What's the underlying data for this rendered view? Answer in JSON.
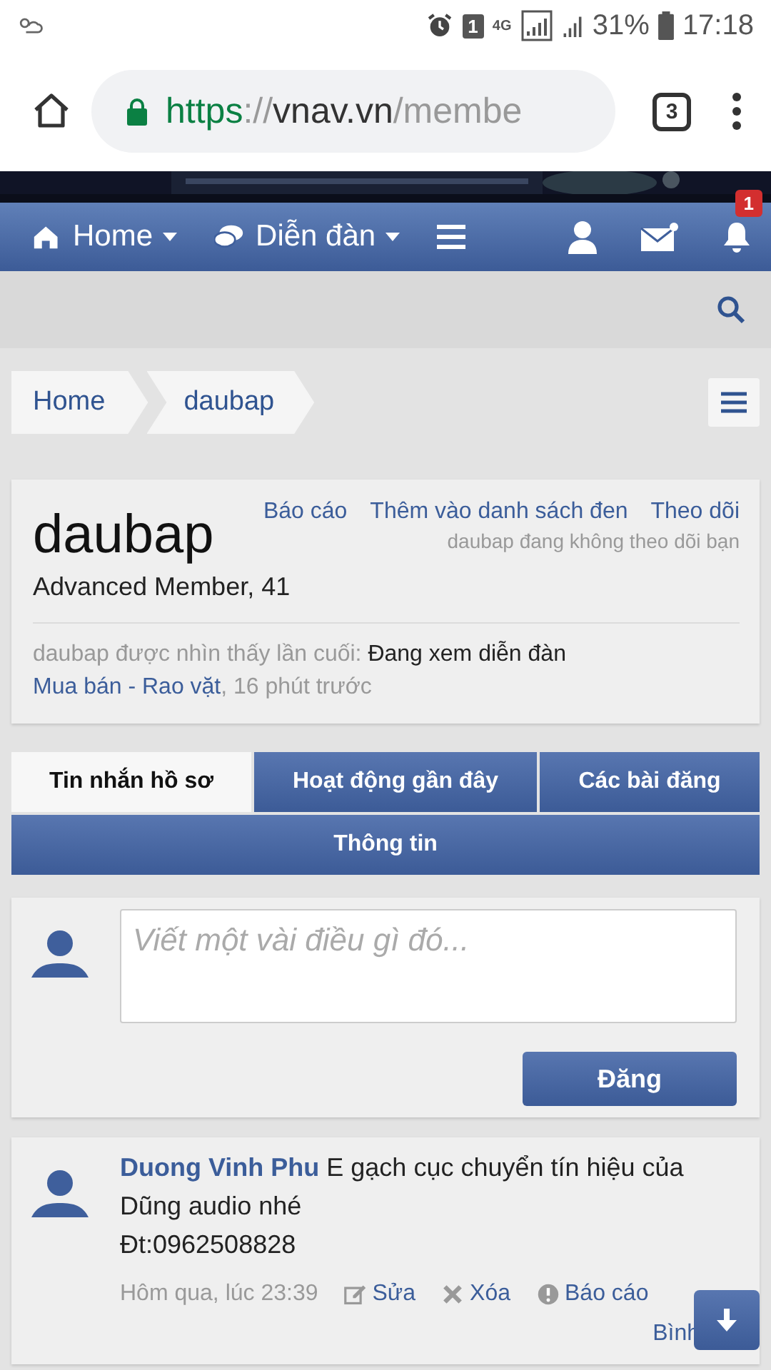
{
  "status_bar": {
    "sim_slot": "1",
    "network": "4G",
    "battery": "31%",
    "time": "17:18"
  },
  "browser": {
    "url": {
      "scheme": "https",
      "separator": "://",
      "host": "vnav.vn",
      "path": "/membe"
    },
    "tab_count": "3"
  },
  "nav": {
    "items": [
      {
        "label": "Home",
        "kind": "home"
      },
      {
        "label": "Diễn đàn",
        "kind": "forum"
      }
    ],
    "alerts_badge": "1"
  },
  "breadcrumb": [
    {
      "label": "Home"
    },
    {
      "label": "daubap"
    }
  ],
  "profile": {
    "name": "daubap",
    "actions": [
      "Báo cáo",
      "Thêm vào danh sách đen",
      "Theo dõi"
    ],
    "follow_note": "daubap đang không theo dõi bạn",
    "title": "Advanced Member, 41",
    "last_seen": {
      "label": "daubap được nhìn thấy lần cuối:",
      "activity": "Đang xem diễn đàn",
      "link": "Mua bán - Rao vặt",
      "ago": ", 16 phút trước"
    }
  },
  "tabs": [
    {
      "label": "Tin nhắn hồ sơ",
      "selected": true
    },
    {
      "label": "Hoạt động gần đây",
      "selected": false
    },
    {
      "label": "Các bài đăng",
      "selected": false
    },
    {
      "label": "Thông tin",
      "selected": false
    }
  ],
  "post_form": {
    "placeholder": "Viết một vài điều gì đó...",
    "button": "Đăng"
  },
  "messages": [
    {
      "author": "Duong Vinh Phu",
      "lines": [
        "E gạch cục chuyển tín hiệu của Dũng audio nhé",
        "Đt:0962508828"
      ],
      "time": "Hôm qua, lúc 23:39",
      "actions": [
        {
          "label": "Sửa",
          "kind": "edit"
        },
        {
          "label": "Xóa",
          "kind": "delete"
        },
        {
          "label": "Báo cáo",
          "kind": "report"
        }
      ],
      "comment_link": "Bình"
    }
  ]
}
